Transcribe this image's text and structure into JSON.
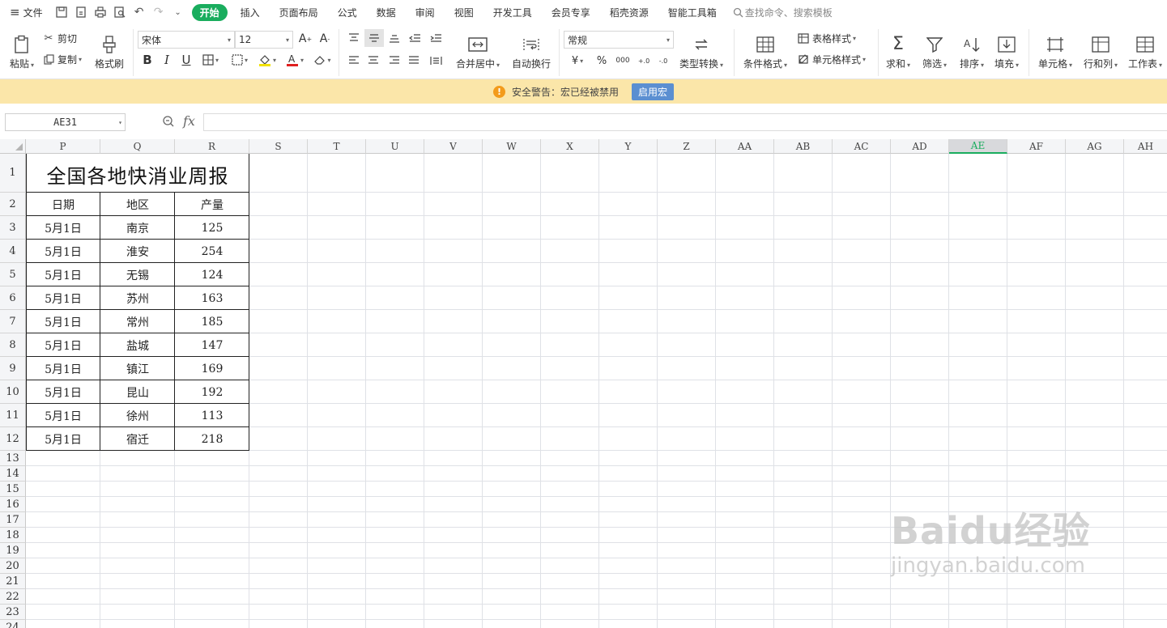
{
  "menu": {
    "file_label": "文件",
    "start_tab": "开始",
    "tabs": [
      "插入",
      "页面布局",
      "公式",
      "数据",
      "审阅",
      "视图",
      "开发工具",
      "会员专享",
      "稻壳资源",
      "智能工具箱"
    ],
    "search_placeholder": "查找命令、搜索模板"
  },
  "ribbon": {
    "paste": "粘贴",
    "cut": "剪切",
    "copy": "复制",
    "format_painter": "格式刷",
    "font_name": "宋体",
    "font_size": "12",
    "merge_center": "合并居中",
    "wrap_text": "自动换行",
    "number_format": "常规",
    "type_convert": "类型转换",
    "conditional_format": "条件格式",
    "table_style": "表格样式",
    "cell_style": "单元格样式",
    "sum": "求和",
    "filter": "筛选",
    "sort": "排序",
    "fill": "填充",
    "cell": "单元格",
    "row_col": "行和列",
    "worksheet": "工作表",
    "currency_symbol": "¥",
    "percent_symbol": "%",
    "thousands_symbol": "000",
    "inc_decimal": "+.0",
    "dec_decimal": "-.0"
  },
  "warning": {
    "text": "安全警告：宏已经被禁用",
    "button": "启用宏"
  },
  "formula_bar": {
    "name_box": "AE31",
    "fx": "fx",
    "value": ""
  },
  "grid": {
    "columns": [
      "P",
      "Q",
      "R",
      "S",
      "T",
      "U",
      "V",
      "W",
      "X",
      "Y",
      "Z",
      "AA",
      "AB",
      "AC",
      "AD",
      "AE",
      "AF",
      "AG",
      "AH"
    ],
    "selected_column": "AE",
    "rows": [
      "1",
      "2",
      "3",
      "4",
      "5",
      "6",
      "7",
      "8",
      "9",
      "10",
      "11",
      "12",
      "13",
      "14",
      "15",
      "16",
      "17",
      "18",
      "19",
      "20",
      "21",
      "22",
      "23",
      "24"
    ]
  },
  "table": {
    "title": "全国各地快消业周报",
    "headers": [
      "日期",
      "地区",
      "产量"
    ],
    "rows": [
      [
        "5月1日",
        "南京",
        "125"
      ],
      [
        "5月1日",
        "淮安",
        "254"
      ],
      [
        "5月1日",
        "无锡",
        "124"
      ],
      [
        "5月1日",
        "苏州",
        "163"
      ],
      [
        "5月1日",
        "常州",
        "185"
      ],
      [
        "5月1日",
        "盐城",
        "147"
      ],
      [
        "5月1日",
        "镇江",
        "169"
      ],
      [
        "5月1日",
        "昆山",
        "192"
      ],
      [
        "5月1日",
        "徐州",
        "113"
      ],
      [
        "5月1日",
        "宿迁",
        "218"
      ]
    ]
  },
  "watermark": {
    "logo": "Baidu经验",
    "url": "jingyan.baidu.com"
  },
  "colors": {
    "accent": "#1aad5e",
    "warning_bg": "#fbe6a9",
    "enable_button": "#5b8fd1"
  }
}
